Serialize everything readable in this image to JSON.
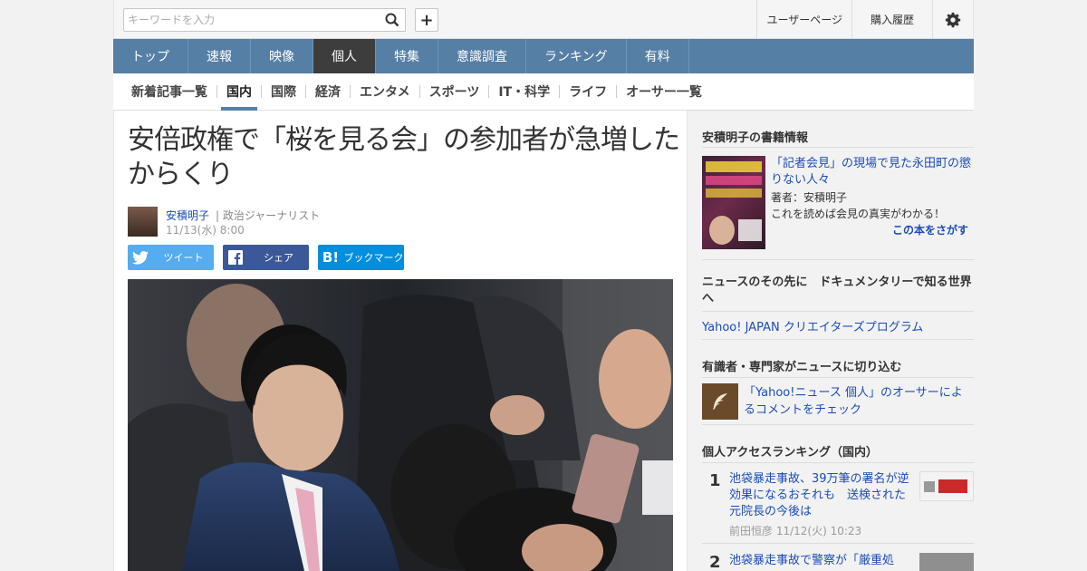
{
  "header": {
    "search_placeholder": "キーワードを入力",
    "user_page": "ユーザーページ",
    "purchase_history": "購入履歴"
  },
  "main_nav": [
    "トップ",
    "速報",
    "映像",
    "個人",
    "特集",
    "意識調査",
    "ランキング",
    "有料"
  ],
  "sub_nav": [
    "新着記事一覧",
    "国内",
    "国際",
    "経済",
    "エンタメ",
    "スポーツ",
    "IT・科学",
    "ライフ",
    "オーサー一覧"
  ],
  "article": {
    "title": "安倍政権で「桜を見る会」の参加者が急増したからくり",
    "author": "安積明子",
    "author_role": "| 政治ジャーナリスト",
    "date": "11/13(水) 8:00",
    "share_tweet": "ツイート",
    "share_facebook": "シェア",
    "share_bookmark": "ブックマーク"
  },
  "sidebar": {
    "books_heading": "安積明子の書籍情報",
    "book_title": "「記者会見」の現場で見た永田町の懲りない人々",
    "book_author": "著者：安積明子",
    "book_desc": "これを読めば会見の真実がわかる！",
    "book_cta": "この本をさがす",
    "doc_heading": "ニュースのその先に　ドキュメンタリーで知る世界へ",
    "doc_link": "Yahoo! JAPAN クリエイターズプログラム",
    "expert_heading": "有識者・専門家がニュースに切り込む",
    "expert_link": "「Yahoo!ニュース 個人」のオーサーによるコメントをチェック",
    "ranking_heading": "個人アクセスランキング（国内）",
    "ranking": [
      {
        "rank": "1",
        "title": "池袋暴走事故、39万筆の署名が逆効果になるおそれも　送検された元院長の今後は",
        "meta": "前田恒彦  11/12(火) 10:23"
      },
      {
        "rank": "2",
        "title": "池袋暴走事故で警察が「厳重処",
        "meta": ""
      }
    ]
  },
  "colors": {
    "nav_bg": "#557fa5",
    "nav_active": "#3d3d3d",
    "link": "#1a4cb8"
  }
}
